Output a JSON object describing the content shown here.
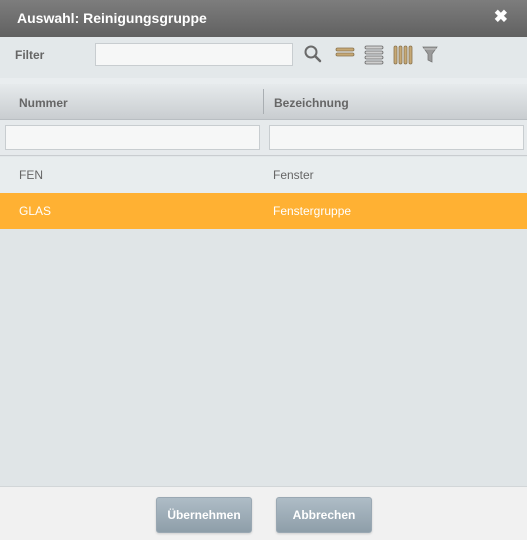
{
  "dialog": {
    "title": "Auswahl: Reinigungsgruppe",
    "close_symbol": "✖"
  },
  "filter": {
    "label": "Filter",
    "value": "",
    "placeholder": ""
  },
  "toolbar": {
    "icons": [
      "search-icon",
      "compact-rows-icon",
      "expanded-rows-icon",
      "columns-icon",
      "filter-icon"
    ]
  },
  "table": {
    "columns": [
      {
        "label": "Nummer"
      },
      {
        "label": "Bezeichnung"
      }
    ],
    "rows": [
      {
        "nummer": "FEN",
        "bezeichnung": "Fenster",
        "selected": false
      },
      {
        "nummer": "GLAS",
        "bezeichnung": "Fenstergruppe",
        "selected": true
      }
    ]
  },
  "buttons": {
    "confirm": "Übernehmen",
    "cancel": "Abbrechen"
  },
  "colors": {
    "titlebar": "#6e6e6e",
    "selected_row": "#ffb133",
    "button": "#9eadb8",
    "icon_tan": "#c6a874"
  }
}
